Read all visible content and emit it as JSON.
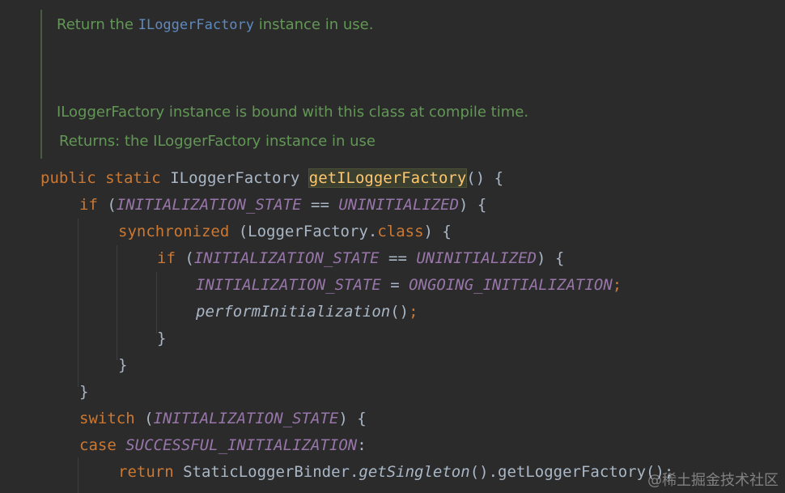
{
  "doc": {
    "line1_pre": "Return the ",
    "line1_code": "ILoggerFactory",
    "line1_post": " instance in use.",
    "line2": "ILoggerFactory instance is bound with this class at compile time.",
    "line3": "Returns: the ILoggerFactory instance in use"
  },
  "code": {
    "l1": {
      "kw1": "public",
      "kw2": "static",
      "type": "ILoggerFactory",
      "method": "getILoggerFactory",
      "rest": "() {"
    },
    "l2": {
      "kw": "if",
      "open": " (",
      "c1": "INITIALIZATION_STATE",
      "op": " == ",
      "c2": "UNINITIALIZED",
      "close": ") {"
    },
    "l3": {
      "kw": "synchronized",
      "open": " (LoggerFactory.",
      "kw2": "class",
      "close": ") {"
    },
    "l4": {
      "kw": "if",
      "open": " (",
      "c1": "INITIALIZATION_STATE",
      "op": " == ",
      "c2": "UNINITIALIZED",
      "close": ") {"
    },
    "l5": {
      "c1": "INITIALIZATION_STATE",
      "op": " = ",
      "c2": "ONGOING_INITIALIZATION",
      "semi": ";"
    },
    "l6": {
      "fn": "performInitialization",
      "paren": "()",
      "semi": ";"
    },
    "l7": {
      "brace": "}"
    },
    "l8": {
      "brace": "}"
    },
    "l9": {
      "brace": "}"
    },
    "l10": {
      "kw": "switch",
      "open": " (",
      "c1": "INITIALIZATION_STATE",
      "close": ") {"
    },
    "l11": {
      "kw": "case",
      "c1": "SUCCESSFUL_INITIALIZATION",
      "colon": ":"
    },
    "l12": {
      "kw": "return",
      "type": " StaticLoggerBinder.",
      "fn": "getSingleton",
      "rest": "().getLoggerFactory();"
    }
  },
  "watermark": "@稀土掘金技术社区",
  "colors": {
    "background": "#2b2b2b",
    "keyword": "#cc7832",
    "constant": "#9876aa",
    "method": "#ffc66d",
    "doc_comment": "#629755",
    "doc_code": "#5f8ac0",
    "text": "#a9b7c6"
  }
}
